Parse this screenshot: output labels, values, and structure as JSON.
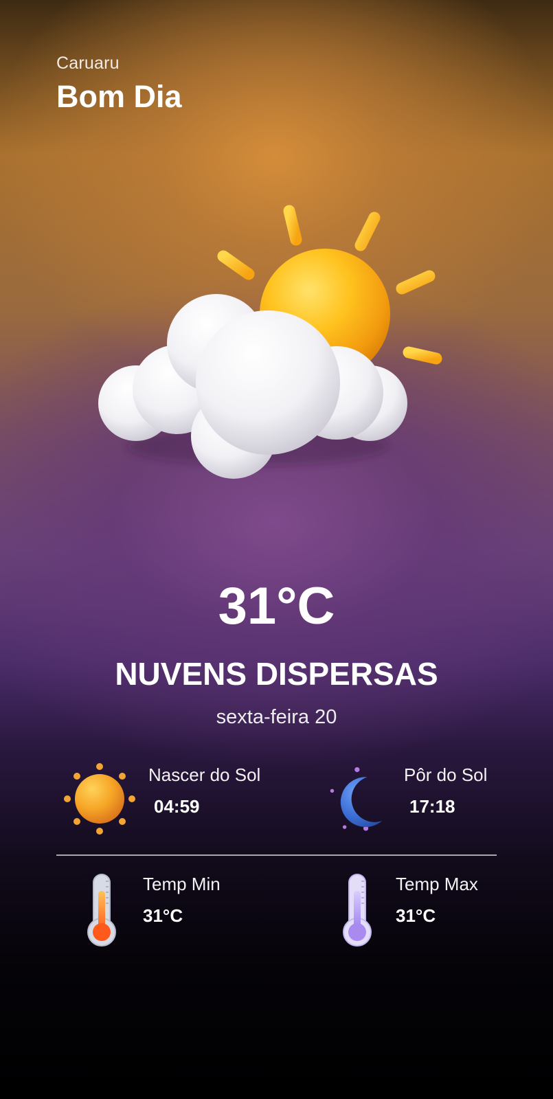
{
  "header": {
    "city": "Caruaru",
    "greeting": "Bom Dia"
  },
  "current": {
    "temperature": "31°C",
    "condition": "NUVENS DISPERSAS",
    "date": "sexta-feira 20",
    "icon": "sun-behind-cloud-icon"
  },
  "details": {
    "sunrise": {
      "label": "Nascer do Sol",
      "value": "04:59",
      "icon": "sun-icon"
    },
    "sunset": {
      "label": "Pôr do Sol",
      "value": "17:18",
      "icon": "moon-icon"
    },
    "temp_min": {
      "label": "Temp Min",
      "value": "31°C",
      "icon": "thermometer-hot-icon"
    },
    "temp_max": {
      "label": "Temp Max",
      "value": "31°C",
      "icon": "thermometer-cold-icon"
    }
  },
  "colors": {
    "sun": "#f7b51c",
    "moon": "#3b6fd6",
    "thermo_warm": "#ff7a1c",
    "thermo_cool": "#a98bf0"
  }
}
